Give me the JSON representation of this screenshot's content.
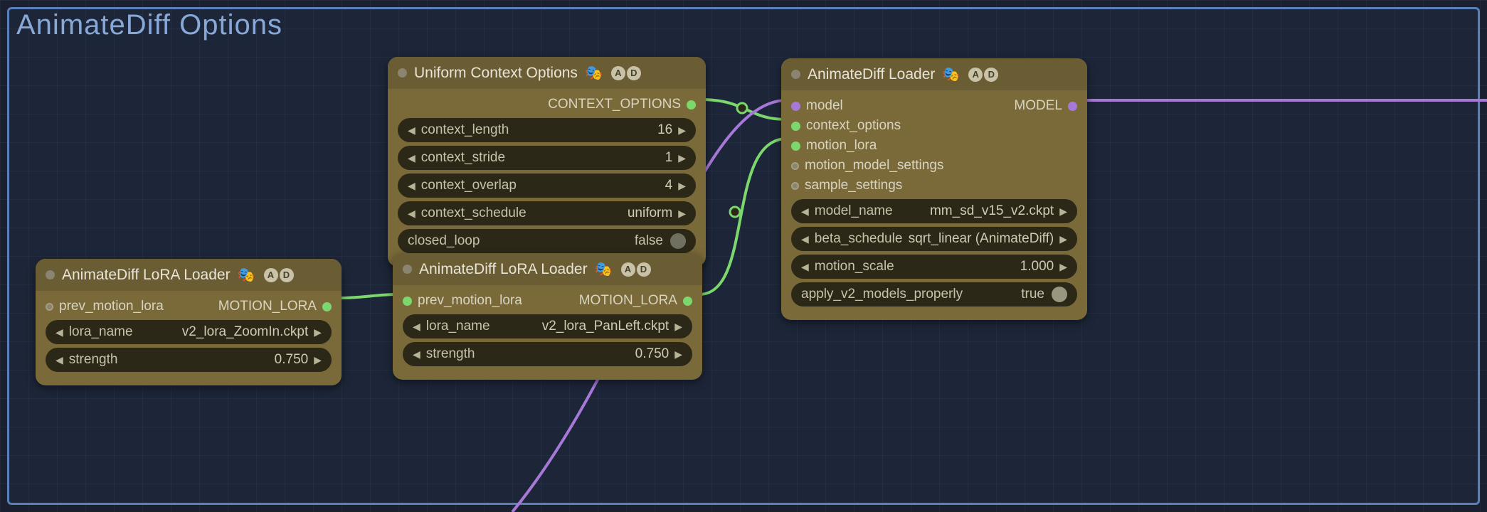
{
  "group": {
    "title": "AnimateDiff Options"
  },
  "badges": {
    "a": "A",
    "d": "D",
    "emoji": "🎭"
  },
  "nodes": {
    "uco": {
      "title": "Uniform Context Options",
      "outputs": {
        "context_options": "CONTEXT_OPTIONS"
      },
      "widgets": {
        "context_length": {
          "label": "context_length",
          "value": "16"
        },
        "context_stride": {
          "label": "context_stride",
          "value": "1"
        },
        "context_overlap": {
          "label": "context_overlap",
          "value": "4"
        },
        "context_schedule": {
          "label": "context_schedule",
          "value": "uniform"
        },
        "closed_loop": {
          "label": "closed_loop",
          "value": "false"
        }
      }
    },
    "lora1": {
      "title": "AnimateDiff LoRA Loader",
      "inputs": {
        "prev_motion_lora": "prev_motion_lora"
      },
      "outputs": {
        "motion_lora": "MOTION_LORA"
      },
      "widgets": {
        "lora_name": {
          "label": "lora_name",
          "value": "v2_lora_ZoomIn.ckpt"
        },
        "strength": {
          "label": "strength",
          "value": "0.750"
        }
      }
    },
    "lora2": {
      "title": "AnimateDiff LoRA Loader",
      "inputs": {
        "prev_motion_lora": "prev_motion_lora"
      },
      "outputs": {
        "motion_lora": "MOTION_LORA"
      },
      "widgets": {
        "lora_name": {
          "label": "lora_name",
          "value": "v2_lora_PanLeft.ckpt"
        },
        "strength": {
          "label": "strength",
          "value": "0.750"
        }
      }
    },
    "loader": {
      "title": "AnimateDiff Loader",
      "inputs": {
        "model": "model",
        "context_options": "context_options",
        "motion_lora": "motion_lora",
        "motion_model_settings": "motion_model_settings",
        "sample_settings": "sample_settings"
      },
      "outputs": {
        "model": "MODEL"
      },
      "widgets": {
        "model_name": {
          "label": "model_name",
          "value": "mm_sd_v15_v2.ckpt"
        },
        "beta_schedule": {
          "label": "beta_schedule",
          "value": "sqrt_linear (AnimateDiff)"
        },
        "motion_scale": {
          "label": "motion_scale",
          "value": "1.000"
        },
        "apply_v2": {
          "label": "apply_v2_models_properly",
          "value": "true"
        }
      }
    }
  }
}
